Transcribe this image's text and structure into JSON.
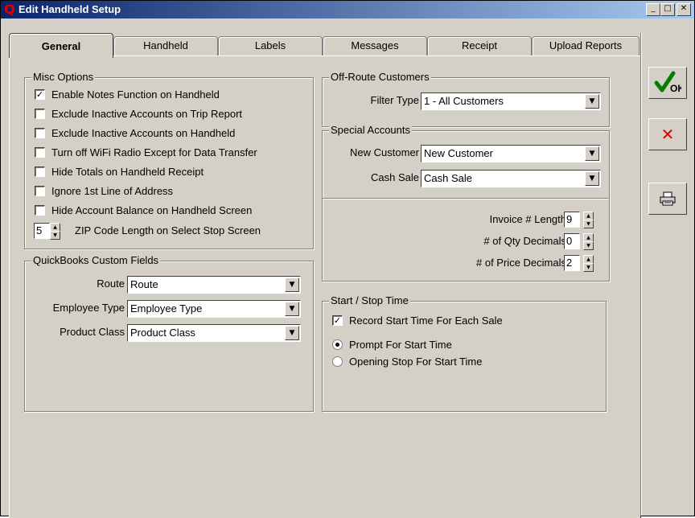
{
  "window": {
    "title": "Edit Handheld Setup",
    "app_icon": "Q"
  },
  "tabs": [
    {
      "label": "General",
      "active": true
    },
    {
      "label": "Handheld",
      "active": false
    },
    {
      "label": "Labels",
      "active": false
    },
    {
      "label": "Messages",
      "active": false
    },
    {
      "label": "Receipt",
      "active": false
    },
    {
      "label": "Upload Reports",
      "active": false
    }
  ],
  "misc_options": {
    "title": "Misc Options",
    "items": [
      {
        "label": "Enable Notes Function on Handheld",
        "checked": true
      },
      {
        "label": "Exclude Inactive Accounts on Trip Report",
        "checked": false
      },
      {
        "label": "Exclude Inactive Accounts on Handheld",
        "checked": false
      },
      {
        "label": "Turn off WiFi Radio Except for Data Transfer",
        "checked": false
      },
      {
        "label": "Hide Totals on Handheld Receipt",
        "checked": false
      },
      {
        "label": "Ignore 1st Line of Address",
        "checked": false
      },
      {
        "label": "Hide Account Balance on Handheld Screen",
        "checked": false
      }
    ],
    "zip_length": {
      "value": "5",
      "label": "ZIP Code Length on Select Stop Screen"
    }
  },
  "qb_fields": {
    "title": "QuickBooks Custom Fields",
    "route": {
      "label": "Route",
      "value": "Route"
    },
    "employee_type": {
      "label": "Employee Type",
      "value": "Employee Type"
    },
    "product_class": {
      "label": "Product Class",
      "value": "Product Class"
    }
  },
  "off_route": {
    "title": "Off-Route Customers",
    "filter": {
      "label": "Filter Type",
      "value": "1 - All Customers"
    }
  },
  "special_accounts": {
    "title": "Special Accounts",
    "new_customer": {
      "label": "New Customer",
      "value": "New Customer"
    },
    "cash_sale": {
      "label": "Cash Sale",
      "value": "Cash Sale"
    }
  },
  "numbers": {
    "invoice_length": {
      "label": "Invoice # Length",
      "value": "9"
    },
    "qty_decimals": {
      "label": "# of Qty Decimals",
      "value": "0"
    },
    "price_decimals": {
      "label": "# of Price Decimals",
      "value": "2"
    }
  },
  "start_stop": {
    "title": "Start / Stop Time",
    "record": {
      "label": "Record Start Time For Each Sale",
      "checked": true
    },
    "options": [
      {
        "label": "Prompt For Start Time",
        "selected": true
      },
      {
        "label": "Opening Stop For Start Time",
        "selected": false
      }
    ]
  },
  "side_buttons": {
    "ok_label": "OK",
    "ok_color": "#008000",
    "cancel_color": "#e00000"
  }
}
